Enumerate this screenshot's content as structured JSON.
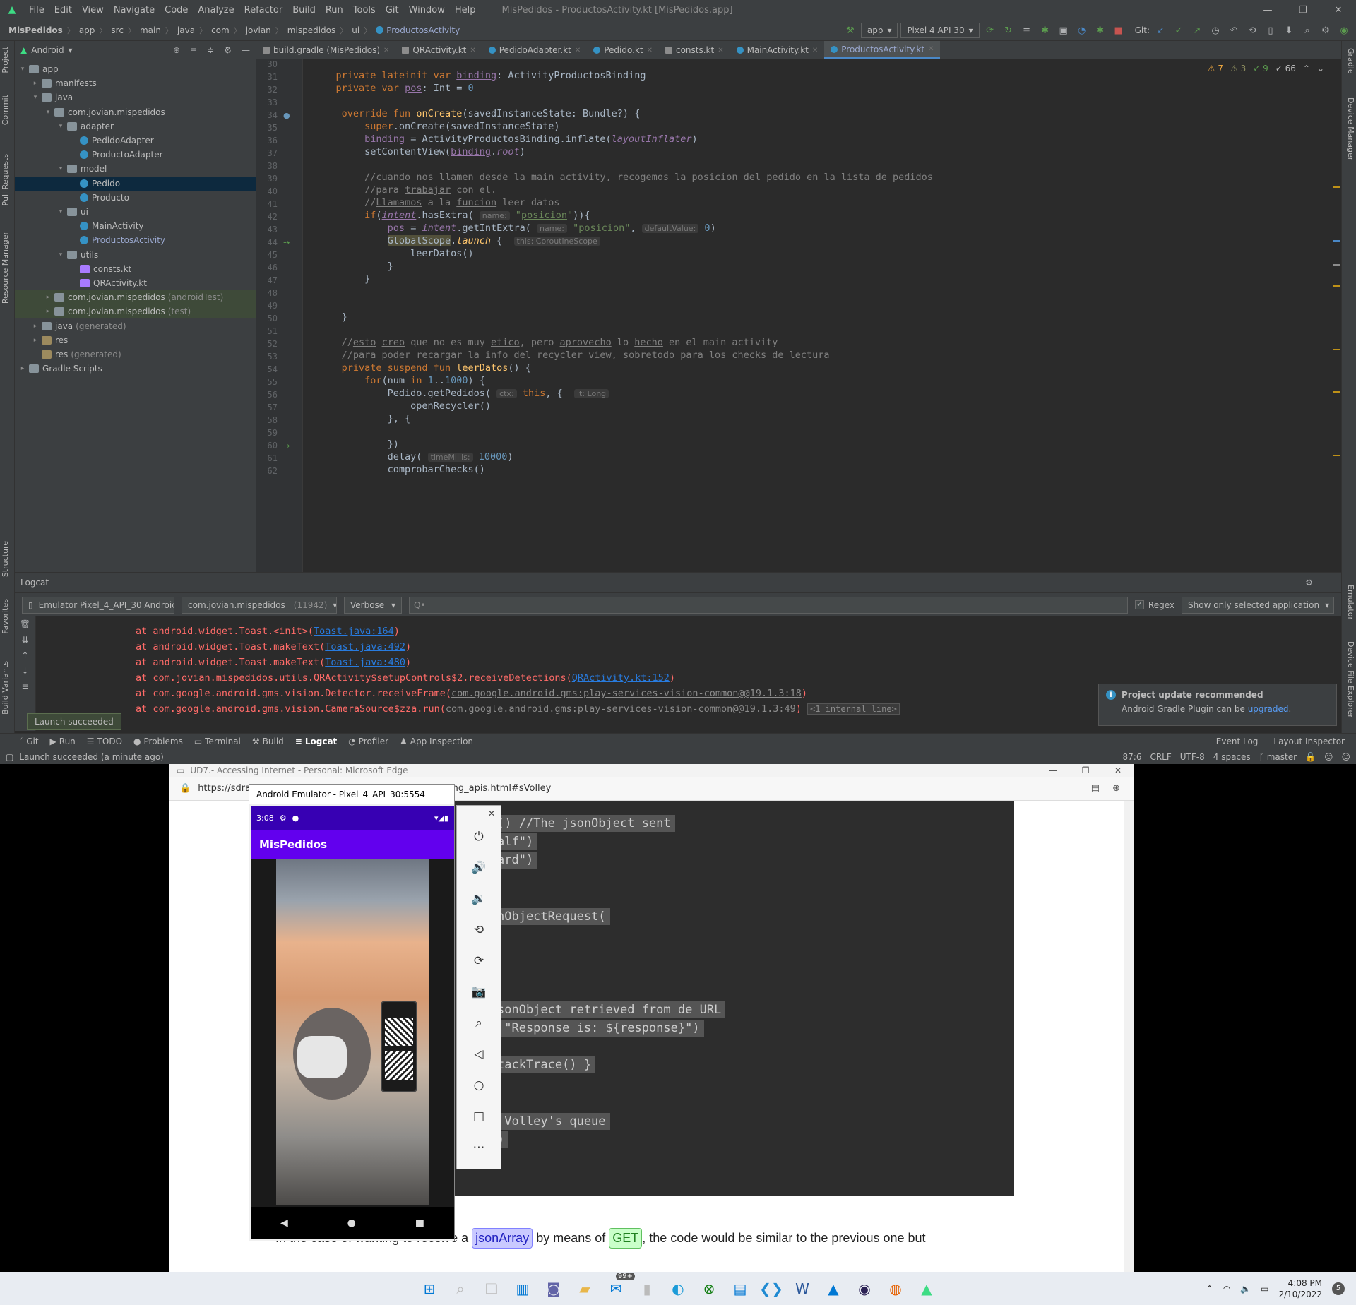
{
  "menu": {
    "items": [
      "File",
      "Edit",
      "View",
      "Navigate",
      "Code",
      "Analyze",
      "Refactor",
      "Build",
      "Run",
      "Tools",
      "Git",
      "Window",
      "Help"
    ],
    "title": "MisPedidos - ProductosActivity.kt [MisPedidos.app]"
  },
  "breadcrumb": [
    "MisPedidos",
    "app",
    "src",
    "main",
    "java",
    "com",
    "jovian",
    "mispedidos",
    "ui",
    "ProductosActivity"
  ],
  "toolbar": {
    "config": "app",
    "device": "Pixel 4 API 30",
    "git_label": "Git:"
  },
  "project": {
    "view": "Android",
    "tree": [
      {
        "label": "app",
        "grey": "",
        "type": "folder",
        "indent": 0,
        "arrow": "▾"
      },
      {
        "label": "manifests",
        "grey": "",
        "type": "folder",
        "indent": 1,
        "arrow": "▸"
      },
      {
        "label": "java",
        "grey": "",
        "type": "folder",
        "indent": 1,
        "arrow": "▾"
      },
      {
        "label": "com.jovian.mispedidos",
        "grey": "",
        "type": "pkg",
        "indent": 2,
        "arrow": "▾"
      },
      {
        "label": "adapter",
        "grey": "",
        "type": "pkg",
        "indent": 3,
        "arrow": "▾"
      },
      {
        "label": "PedidoAdapter",
        "grey": "",
        "type": "cls",
        "indent": 4,
        "arrow": ""
      },
      {
        "label": "ProductoAdapter",
        "grey": "",
        "type": "cls",
        "indent": 4,
        "arrow": ""
      },
      {
        "label": "model",
        "grey": "",
        "type": "pkg",
        "indent": 3,
        "arrow": "▾"
      },
      {
        "label": "Pedido",
        "grey": "",
        "type": "cls",
        "indent": 4,
        "arrow": "",
        "state": "sel"
      },
      {
        "label": "Producto",
        "grey": "",
        "type": "cls",
        "indent": 4,
        "arrow": ""
      },
      {
        "label": "ui",
        "grey": "",
        "type": "pkg",
        "indent": 3,
        "arrow": "▾"
      },
      {
        "label": "MainActivity",
        "grey": "",
        "type": "cls",
        "indent": 4,
        "arrow": ""
      },
      {
        "label": "ProductosActivity",
        "grey": "",
        "type": "cls",
        "indent": 4,
        "arrow": "",
        "state": "file"
      },
      {
        "label": "utils",
        "grey": "",
        "type": "pkg",
        "indent": 3,
        "arrow": "▾"
      },
      {
        "label": "consts.kt",
        "grey": "",
        "type": "kt",
        "indent": 4,
        "arrow": ""
      },
      {
        "label": "QRActivity.kt",
        "grey": "",
        "type": "kt",
        "indent": 4,
        "arrow": ""
      },
      {
        "label": "com.jovian.mispedidos",
        "grey": "(androidTest)",
        "type": "pkg",
        "indent": 2,
        "arrow": "▸",
        "state": "hl"
      },
      {
        "label": "com.jovian.mispedidos",
        "grey": "(test)",
        "type": "pkg",
        "indent": 2,
        "arrow": "▸",
        "state": "hl"
      },
      {
        "label": "java",
        "grey": "(generated)",
        "type": "folder",
        "indent": 1,
        "arrow": "▸"
      },
      {
        "label": "res",
        "grey": "",
        "type": "res",
        "indent": 1,
        "arrow": "▸"
      },
      {
        "label": "res",
        "grey": "(generated)",
        "type": "res",
        "indent": 1,
        "arrow": ""
      },
      {
        "label": "Gradle Scripts",
        "grey": "",
        "type": "folder",
        "indent": 0,
        "arrow": "▸"
      }
    ]
  },
  "tabs": [
    {
      "label": "build.gradle (MisPedidos)",
      "icon": "g"
    },
    {
      "label": "QRActivity.kt",
      "icon": "g"
    },
    {
      "label": "PedidoAdapter.kt",
      "icon": "c"
    },
    {
      "label": "Pedido.kt",
      "icon": "c"
    },
    {
      "label": "consts.kt",
      "icon": "g"
    },
    {
      "label": "MainActivity.kt",
      "icon": "c"
    },
    {
      "label": "ProductosActivity.kt",
      "icon": "c",
      "active": true
    }
  ],
  "inspections": {
    "warnings": "7",
    "weak": "3",
    "typos": "9",
    "infos": "66"
  },
  "code_lines": [
    {
      "n": "30",
      "h": ""
    },
    {
      "n": "31",
      "h": "    <span class='kw'>private lateinit var</span> <span class='pr ul'>binding</span>: ActivityProductosBinding"
    },
    {
      "n": "32",
      "h": "    <span class='kw'>private var</span> <span class='pr ul'>pos</span>: Int = <span class='num'>0</span>"
    },
    {
      "n": "33",
      "h": ""
    },
    {
      "n": "34",
      "h": "     <span class='kw'>override fun</span> <span class='fn'>onCreate</span>(savedInstanceState: Bundle?) {"
    },
    {
      "n": "35",
      "h": "         <span class='kw'>super</span>.onCreate(savedInstanceState)"
    },
    {
      "n": "36",
      "h": "         <span class='pr ul'>binding</span> = ActivityProductosBinding.inflate(<span class='it'>layoutInflater</span>)"
    },
    {
      "n": "37",
      "h": "         setContentView(<span class='pr ul'>binding</span>.<span class='it'>root</span>)"
    },
    {
      "n": "38",
      "h": ""
    },
    {
      "n": "39",
      "h": "         <span class='cm'>//<span class='ul'>cuando</span> nos <span class='ul'>llamen</span> <span class='ul'>desde</span> la main activity, <span class='ul'>recogemos</span> la <span class='ul'>posicion</span> del <span class='ul'>pedido</span> en la <span class='ul'>lista</span> de <span class='ul'>pedidos</span></span>"
    },
    {
      "n": "40",
      "h": "         <span class='cm'>//para <span class='ul'>trabajar</span> con el.</span>"
    },
    {
      "n": "41",
      "h": "         <span class='cm'>//<span class='ul'>Llamamos</span> a la <span class='ul'>funcion</span> leer datos</span>"
    },
    {
      "n": "42",
      "h": "         <span class='kw'>if</span>(<span class='it ul'>intent</span>.hasExtra( <span class='hint'>name:</span> <span class='str'>\"<span class='ul'>posicion</span>\"</span>)){"
    },
    {
      "n": "43",
      "h": "             <span class='pr ul'>pos</span> = <span class='it ul'>intent</span>.getIntExtra( <span class='hint'>name:</span> <span class='str'>\"<span class='ul'>posicion</span>\"</span>, <span class='hint'>defaultValue:</span> <span class='num'>0</span>)"
    },
    {
      "n": "44",
      "h": "             <span style='background:#52503a'>GlobalScope</span>.<span class='fn' style='font-style:italic'>launch</span> {  <span class='hint'>this: CoroutineScope</span>"
    },
    {
      "n": "45",
      "h": "                 leerDatos()"
    },
    {
      "n": "46",
      "h": "             }"
    },
    {
      "n": "47",
      "h": "         }"
    },
    {
      "n": "48",
      "h": ""
    },
    {
      "n": "49",
      "h": ""
    },
    {
      "n": "50",
      "h": "     }"
    },
    {
      "n": "51",
      "h": ""
    },
    {
      "n": "52",
      "h": "     <span class='cm'>//<span class='ul'>esto</span> <span class='ul'>creo</span> que no es muy <span class='ul'>etico</span>, pero <span class='ul'>aprovecho</span> lo <span class='ul'>hecho</span> en el main activity</span>"
    },
    {
      "n": "53",
      "h": "     <span class='cm'>//para <span class='ul'>poder</span> <span class='ul'>recargar</span> la info del recycler view, <span class='ul'>sobretodo</span> para los checks de <span class='ul'>lectura</span></span>"
    },
    {
      "n": "54",
      "h": "     <span class='kw'>private suspend fun</span> <span class='fn'>leerDatos</span>() {"
    },
    {
      "n": "55",
      "h": "         <span class='kw'>for</span>(num <span class='kw'>in</span> <span class='num'>1</span>..<span class='num'>1000</span>) {"
    },
    {
      "n": "56",
      "h": "             Pedido.getPedidos( <span class='hint'>ctx:</span> <span class='kw'>this</span>, {  <span class='hint'>it: Long</span>"
    },
    {
      "n": "57",
      "h": "                 openRecycler()"
    },
    {
      "n": "58",
      "h": "             }, {"
    },
    {
      "n": "59",
      "h": ""
    },
    {
      "n": "60",
      "h": "             })"
    },
    {
      "n": "61",
      "h": "             delay( <span class='hint'>timeMillis:</span> <span class='num'>10000</span>)"
    },
    {
      "n": "62",
      "h": "             comprobarChecks()"
    }
  ],
  "logcat": {
    "title": "Logcat",
    "device": "Emulator Pixel_4_API_30 Androic",
    "process": "com.jovian.mispedidos",
    "pid": "(11942)",
    "level": "Verbose",
    "search_placeholder": "Q•",
    "regex": "Regex",
    "filter": "Show only selected application",
    "lines": [
      "        at android.widget.Toast.&lt;init&gt;(<span class='lk'>Toast.java:164</span>)",
      "        at android.widget.Toast.makeText(<span class='lk'>Toast.java:492</span>)",
      "        at android.widget.Toast.makeText(<span class='lk'>Toast.java:480</span>)",
      "        at com.jovian.mispedidos.utils.QRActivity$setupControls$2.receiveDetections(<span class='lk'>QRActivity.kt:152</span>)",
      "        at com.google.android.gms.vision.Detector.receiveFrame(<span class='lkg'>com.google.android.gms:play-services-vision-common@@19.1.3:18</span>)",
      "        at com.google.android.gms.vision.CameraSource$zza.run(<span class='lkg'>com.google.android.gms:play-services-vision-common@@19.1.3:49</span>) <span class='fold'>&lt;1 internal line&gt;</span>"
    ]
  },
  "notification": {
    "title": "Project update recommended",
    "body": "Android Gradle Plugin can be",
    "link": "upgraded",
    "end": "."
  },
  "launch_tip": "Launch succeeded",
  "bottom_tabs": [
    "Git",
    "Run",
    "TODO",
    "Problems",
    "Terminal",
    "Build",
    "Logcat",
    "Profiler",
    "App Inspection"
  ],
  "bottom_right": [
    "Event Log",
    "Layout Inspector"
  ],
  "status": {
    "left": "Launch succeeded (a minute ago)",
    "pos": "87:6",
    "eol": "CRLF",
    "enc": "UTF-8",
    "indent": "4 spaces",
    "branch": "master"
  },
  "left_tools": [
    "Project",
    "Commit",
    "Pull Requests",
    "Resource Manager",
    "Structure",
    "Favorites",
    "Build Variants"
  ],
  "right_tools": [
    "Gradle",
    "Device Manager",
    "Emulator",
    "Device File Explorer"
  ],
  "edge": {
    "title": "UD7.- Accessing Internet - Personal: Microsoft Edge",
    "url_a": "https://sdra",
    "url_b": "onsuming_apis.html#sVolley"
  },
  "web_code": [
    "() //The jsonObject sent",
    "alf\")",
    "ard\")",
    "nObjectRequest(",
    "sonObject retrieved from de URL",
    " \"Response is: ${response}\")",
    "tackTrace() }",
    " Volley's queue",
    ")"
  ],
  "web_text": {
    "a": "In the case of wanting to receive a ",
    "b": "jsonArray",
    "c": " by means of ",
    "d": "GET",
    "e": ", the code would be similar to the previous one but"
  },
  "emulator": {
    "title": "Android Emulator - Pixel_4_API_30:5554",
    "time": "3:08",
    "app_title": "MisPedidos"
  },
  "taskbar": {
    "time": "4:08 PM",
    "date": "2/10/2022",
    "badge": "99+",
    "notif": "5"
  }
}
